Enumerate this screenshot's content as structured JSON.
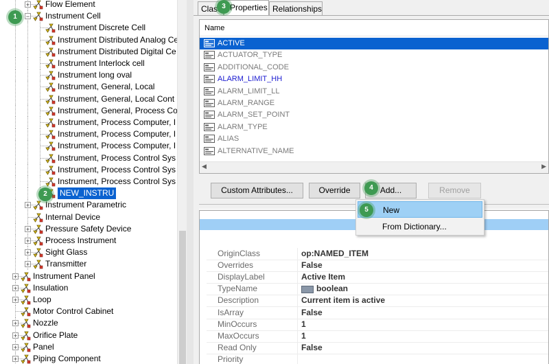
{
  "tree": {
    "items": [
      {
        "label": "Flow Element",
        "level": 2,
        "expander": "+"
      },
      {
        "label": "Instrument Cell",
        "level": 2,
        "expander": "-"
      },
      {
        "label": "Instrument Discrete Cell",
        "level": 3
      },
      {
        "label": "Instrument Distributed Analog Ce",
        "level": 3
      },
      {
        "label": "Instrument Distributed Digital Ce",
        "level": 3
      },
      {
        "label": "Instrument Interlock cell",
        "level": 3
      },
      {
        "label": "Instrument long oval",
        "level": 3
      },
      {
        "label": "Instrument, General, Local",
        "level": 3
      },
      {
        "label": "Instrument, General, Local Cont",
        "level": 3
      },
      {
        "label": "Instrument, General, Process Co",
        "level": 3
      },
      {
        "label": "Instrument, Process Computer, I",
        "level": 3
      },
      {
        "label": "Instrument, Process Computer, I",
        "level": 3
      },
      {
        "label": "Instrument, Process Computer, I",
        "level": 3
      },
      {
        "label": "Instrument, Process Control Sys",
        "level": 3
      },
      {
        "label": "Instrument, Process Control Sys",
        "level": 3
      },
      {
        "label": "Instrument, Process Control Sys",
        "level": 3
      },
      {
        "label": "NEW_INSTRU",
        "level": 3,
        "selected": true
      },
      {
        "label": "Instrument Parametric",
        "level": 2,
        "expander": "+"
      },
      {
        "label": "Internal Device",
        "level": 2
      },
      {
        "label": "Pressure Safety Device",
        "level": 2,
        "expander": "+"
      },
      {
        "label": "Process Instrument",
        "level": 2,
        "expander": "+"
      },
      {
        "label": "Sight Glass",
        "level": 2,
        "expander": "+"
      },
      {
        "label": "Transmitter",
        "level": 2,
        "expander": "+"
      },
      {
        "label": "Instrument Panel",
        "level": 1,
        "expander": "+"
      },
      {
        "label": "Insulation",
        "level": 1,
        "expander": "+"
      },
      {
        "label": "Loop",
        "level": 1,
        "expander": "+"
      },
      {
        "label": "Motor Control Cabinet",
        "level": 1
      },
      {
        "label": "Nozzle",
        "level": 1,
        "expander": "+"
      },
      {
        "label": "Orifice Plate",
        "level": 1,
        "expander": "+"
      },
      {
        "label": "Panel",
        "level": 1,
        "expander": "+"
      },
      {
        "label": "Piping Component",
        "level": 1,
        "expander": "+"
      }
    ]
  },
  "tabs": {
    "class_label": "Class",
    "properties_label": "Properties",
    "relationships_label": "Relationships"
  },
  "properties": {
    "header": "Name",
    "items": [
      {
        "name": "ACTIVE",
        "selected": true
      },
      {
        "name": "ACTUATOR_TYPE"
      },
      {
        "name": "ADDITIONAL_CODE"
      },
      {
        "name": "ALARM_LIMIT_HH",
        "highlight": true
      },
      {
        "name": "ALARM_LIMIT_LL"
      },
      {
        "name": "ALARM_RANGE"
      },
      {
        "name": "ALARM_SET_POINT"
      },
      {
        "name": "ALARM_TYPE"
      },
      {
        "name": "ALIAS"
      },
      {
        "name": "ALTERNATIVE_NAME"
      }
    ]
  },
  "buttons": {
    "custom_attributes": "Custom Attributes...",
    "override": "Override",
    "add": "Add...",
    "remove": "Remove"
  },
  "menu": {
    "new": "New",
    "from_dictionary": "From Dictionary..."
  },
  "details": {
    "rows": [
      {
        "key": "OriginClass",
        "value": "op:NAMED_ITEM"
      },
      {
        "key": "Overrides",
        "value": "False"
      },
      {
        "key": "DisplayLabel",
        "value": "Active Item"
      },
      {
        "key": "TypeName",
        "value": "boolean",
        "icon": true
      },
      {
        "key": "Description",
        "value": "Current item is active"
      },
      {
        "key": "IsArray",
        "value": "False"
      },
      {
        "key": "MinOccurs",
        "value": "1"
      },
      {
        "key": "MaxOccurs",
        "value": "1"
      },
      {
        "key": "Read Only",
        "value": "False"
      },
      {
        "key": "Priority",
        "value": ""
      }
    ]
  },
  "badges": [
    "1",
    "2",
    "3",
    "4",
    "5"
  ],
  "colors": {
    "selection": "#0a62d0",
    "badge": "#3e9a52",
    "menu_highlight": "#9ed0f5",
    "blue_text": "#1a1ad0"
  }
}
